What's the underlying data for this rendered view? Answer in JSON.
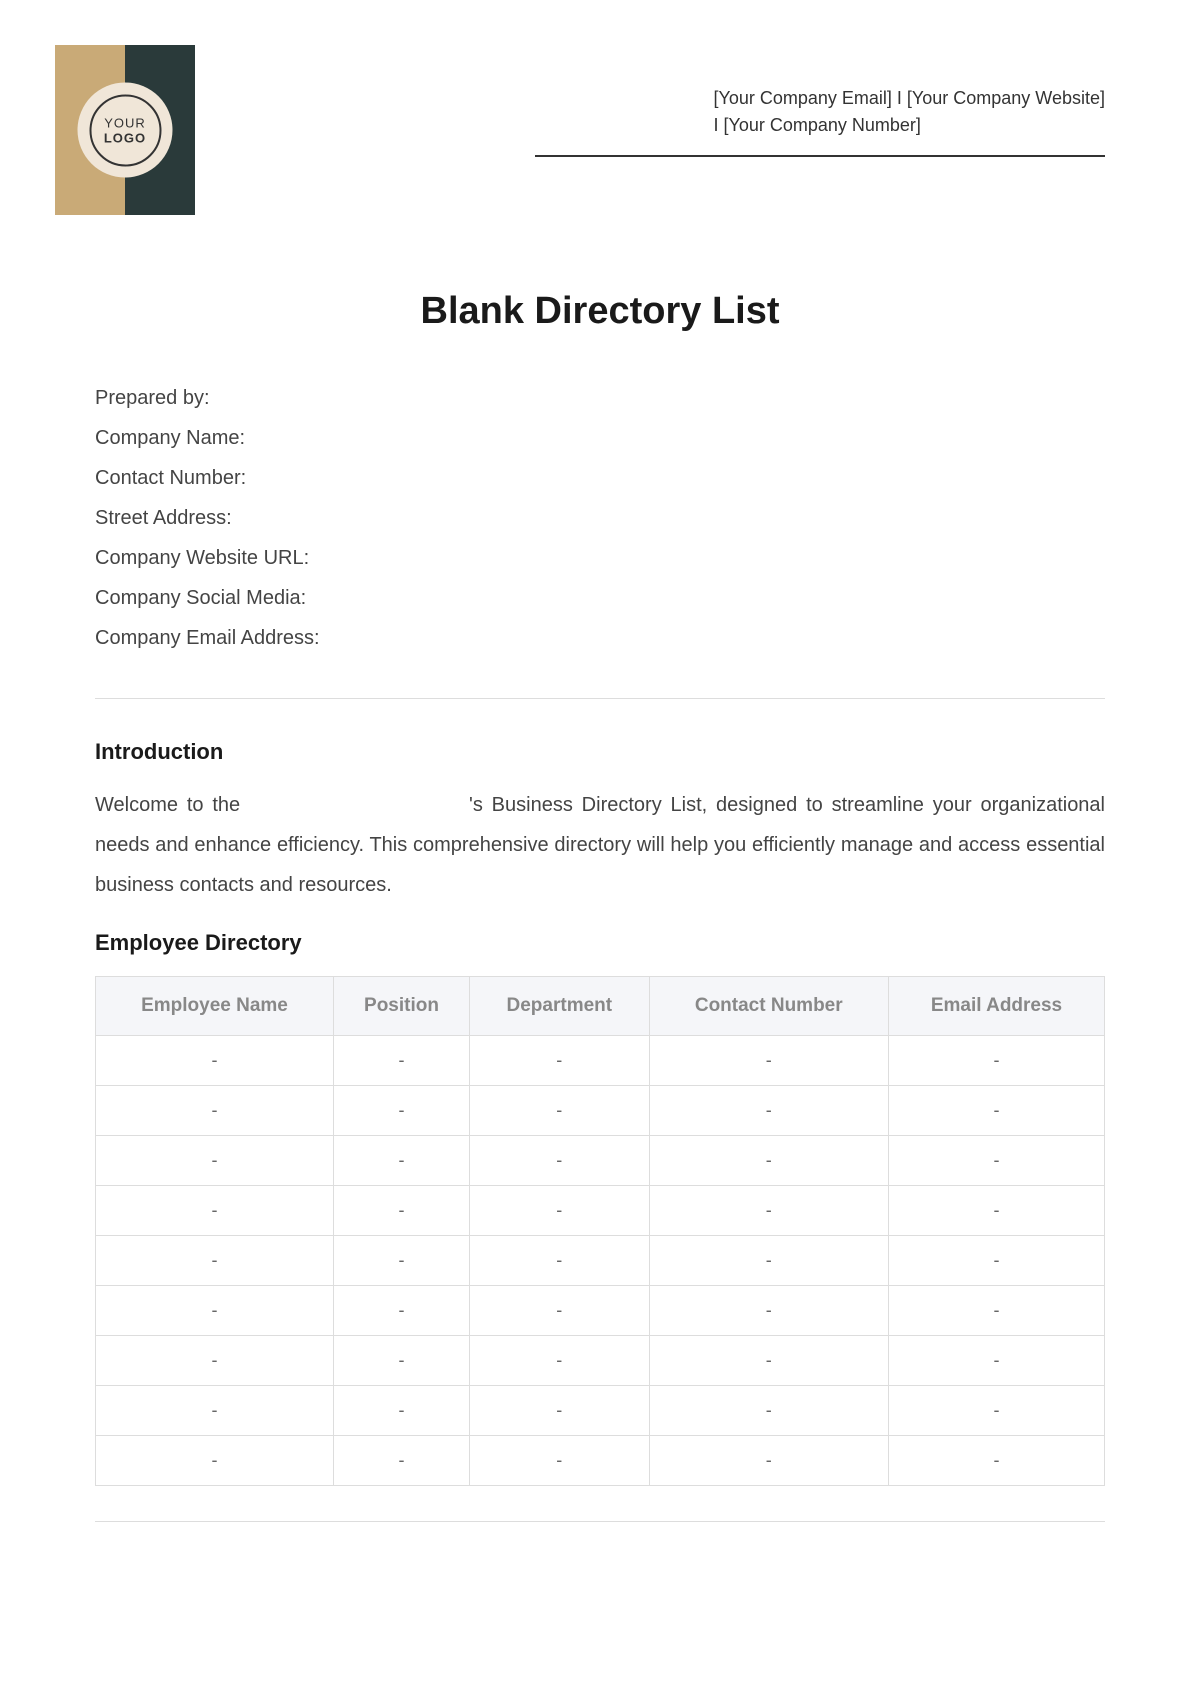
{
  "logo": {
    "line1": "YOUR",
    "line2": "LOGO"
  },
  "header": {
    "line1": "[Your Company Email] I [Your Company Website]",
    "line2": "I [Your Company Number]"
  },
  "title": "Blank Directory List",
  "info_fields": [
    "Prepared by:",
    "Company Name:",
    "Contact Number:",
    "Street Address:",
    "Company Website URL:",
    "Company Social Media:",
    "Company Email Address:"
  ],
  "intro": {
    "heading": "Introduction",
    "text_pre": "Welcome to the ",
    "text_post": "'s Business Directory List, designed to streamline your organizational needs and enhance efficiency. This comprehensive directory will help you efficiently manage and access essential business contacts and resources."
  },
  "employee_dir": {
    "heading": "Employee Directory",
    "columns": [
      "Employee Name",
      "Position",
      "Department",
      "Contact Number",
      "Email Address"
    ],
    "rows": [
      [
        "-",
        "-",
        "-",
        "-",
        "-"
      ],
      [
        "-",
        "-",
        "-",
        "-",
        "-"
      ],
      [
        "-",
        "-",
        "-",
        "-",
        "-"
      ],
      [
        "-",
        "-",
        "-",
        "-",
        "-"
      ],
      [
        "-",
        "-",
        "-",
        "-",
        "-"
      ],
      [
        "-",
        "-",
        "-",
        "-",
        "-"
      ],
      [
        "-",
        "-",
        "-",
        "-",
        "-"
      ],
      [
        "-",
        "-",
        "-",
        "-",
        "-"
      ],
      [
        "-",
        "-",
        "-",
        "-",
        "-"
      ]
    ]
  }
}
